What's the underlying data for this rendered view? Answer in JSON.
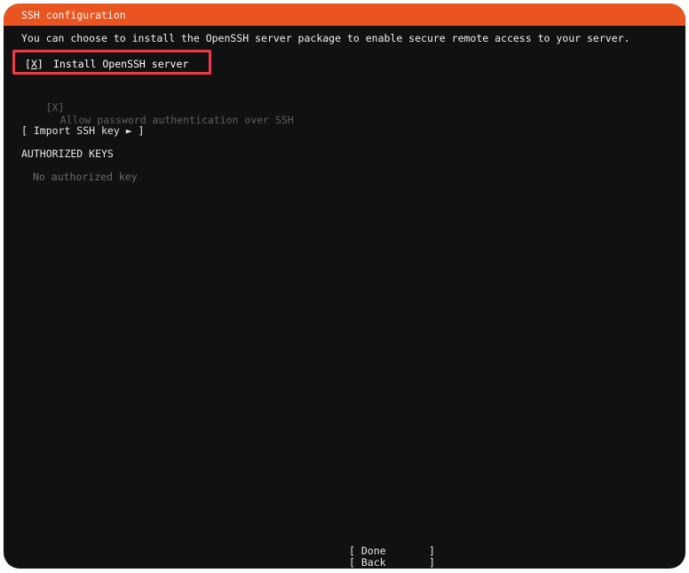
{
  "window": {
    "title": "SSH configuration"
  },
  "description": "You can choose to install the OpenSSH server package to enable secure remote access to your server.",
  "install_option": {
    "checkbox": "[X]",
    "label": "Install OpenSSH server",
    "checked": true
  },
  "password_option": {
    "checkbox": "[X]",
    "label": "Allow password authentication over SSH",
    "checked": true,
    "disabled": true
  },
  "import_button": {
    "label": "[ Import SSH key ► ]"
  },
  "authorized_keys": {
    "heading": "AUTHORIZED KEYS",
    "empty_text": "No authorized key"
  },
  "footer": {
    "done_label": "[ Done       ]",
    "back_label": "[ Back       ]"
  },
  "colors": {
    "title_bar": "#e95420",
    "focus_outline": "#ee3b47",
    "background": "#111111"
  }
}
